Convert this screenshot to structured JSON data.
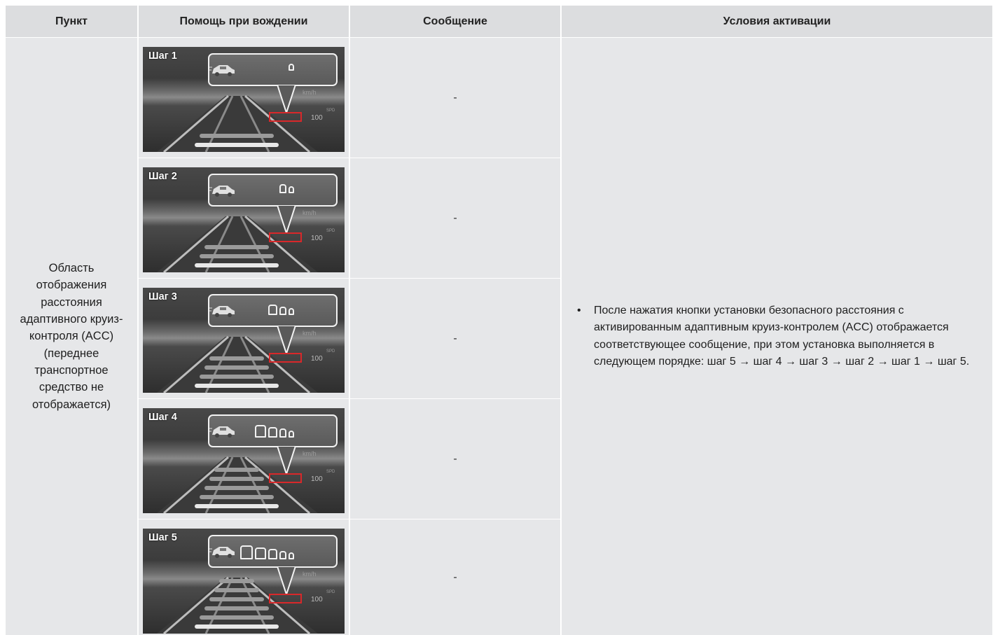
{
  "table": {
    "headers": [
      "Пункт",
      "Помощь при вождении",
      "Сообщение",
      "Условия активации"
    ],
    "item": "Область отображения расстояния адаптивного круиз-контроля (ACC) (переднее транспортное средство не отображается)",
    "steps": [
      {
        "label": "Шаг 1",
        "level": 1,
        "message": "-"
      },
      {
        "label": "Шаг 2",
        "level": 2,
        "message": "-"
      },
      {
        "label": "Шаг 3",
        "level": 3,
        "message": "-"
      },
      {
        "label": "Шаг 4",
        "level": 4,
        "message": "-"
      },
      {
        "label": "Шаг 5",
        "level": 5,
        "message": "-"
      }
    ],
    "condition": "После нажатия кнопки установки безопасного расстояния с активированным адаптивным круиз-контролем (ACC) отображается соответствующее сообщение, при этом установка выполняется в следующем порядке: шаг 5 → шаг 4 → шаг 3 → шаг 2 → шаг 1 → шаг 5."
  },
  "hud": {
    "speed_unit": "km/h",
    "set_label": "SPD",
    "set_speed": "100",
    "icons": [
      "car-icon",
      "distance-bar-icon"
    ]
  }
}
